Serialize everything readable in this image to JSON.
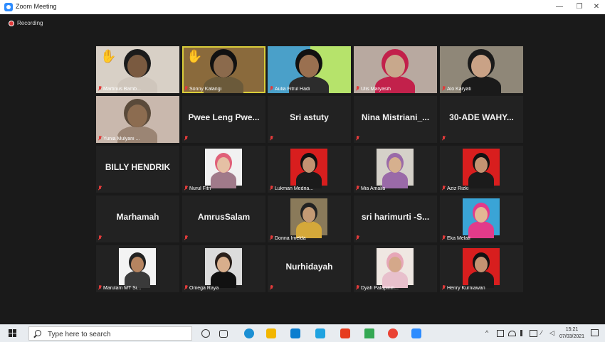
{
  "window": {
    "title": "Zoom Meeting",
    "minimize": "—",
    "restore": "❐",
    "close": "✕"
  },
  "recording": {
    "label": "Recording"
  },
  "tiles": [
    {
      "label": "Martinus Bamb...",
      "type": "video",
      "hand": true
    },
    {
      "label": "Sonny Kalangi",
      "type": "video",
      "hand": true,
      "active": true
    },
    {
      "label": "Aulia Fitrul Hadi",
      "type": "video"
    },
    {
      "label": "Ulis Maryasih",
      "type": "video"
    },
    {
      "label": "Alo Karyati",
      "type": "video"
    },
    {
      "label": "Yunia Mulyani ...",
      "type": "video"
    },
    {
      "name": "Pwee Leng Pwe...",
      "type": "name"
    },
    {
      "name": "Sri astuty",
      "type": "name"
    },
    {
      "name": "Nina Mistriani_...",
      "type": "name"
    },
    {
      "name": "30-ADE WAHY...",
      "type": "name"
    },
    {
      "name": "BILLY HENDRIK",
      "type": "name"
    },
    {
      "label": "Nurul Fitri",
      "type": "photo"
    },
    {
      "label": "Lukman Medria...",
      "type": "photo"
    },
    {
      "label": "Mia Amalia",
      "type": "photo"
    },
    {
      "label": "Aziz Rizki",
      "type": "photo"
    },
    {
      "name": "Marhamah",
      "type": "name"
    },
    {
      "name": "AmrusSalam",
      "type": "name"
    },
    {
      "label": "Donna Imelda",
      "type": "photo"
    },
    {
      "name": "sri harimurti -S...",
      "type": "name"
    },
    {
      "label": "Eka Melati",
      "type": "photo"
    },
    {
      "label": "Marulam MT Si...",
      "type": "photo"
    },
    {
      "label": "Omega Raya",
      "type": "photo"
    },
    {
      "name": "Nurhidayah",
      "type": "name"
    },
    {
      "label": "Dyah Palupinin...",
      "type": "photo"
    },
    {
      "label": "Henry Kurniawan",
      "type": "photo"
    }
  ],
  "taskbar": {
    "search_placeholder": "Type here to search",
    "time": "15:21",
    "date": "07/03/2021"
  }
}
